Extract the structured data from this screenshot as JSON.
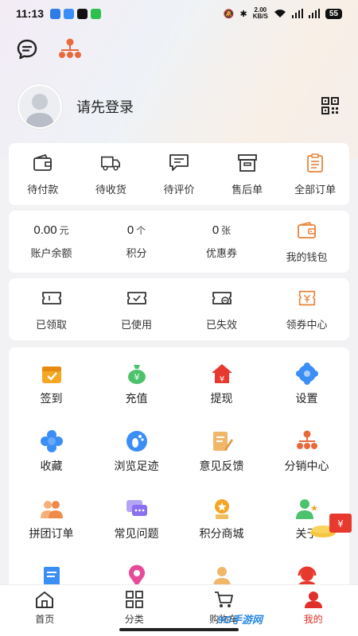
{
  "status_bar": {
    "time": "11:13",
    "net_speed": "2.00",
    "net_unit": "KB/S",
    "battery": "55"
  },
  "profile": {
    "login_prompt": "请先登录"
  },
  "orders": [
    {
      "label": "待付款",
      "icon": "wallet-icon"
    },
    {
      "label": "待收货",
      "icon": "truck-icon"
    },
    {
      "label": "待评价",
      "icon": "comment-icon"
    },
    {
      "label": "售后单",
      "icon": "box-icon"
    },
    {
      "label": "全部订单",
      "icon": "clipboard-icon"
    }
  ],
  "assets": [
    {
      "value": "0.00",
      "unit": "元",
      "label": "账户余额"
    },
    {
      "value": "0",
      "unit": "个",
      "label": "积分"
    },
    {
      "value": "0",
      "unit": "张",
      "label": "优惠券"
    },
    {
      "label": "我的钱包",
      "icon": "wallet-icon"
    }
  ],
  "coupons": [
    {
      "label": "已领取",
      "icon": "ticket-icon"
    },
    {
      "label": "已使用",
      "icon": "ticket-used-icon"
    },
    {
      "label": "已失效",
      "icon": "ticket-expired-icon"
    },
    {
      "label": "领券中心",
      "icon": "coupon-center-icon"
    }
  ],
  "services": [
    {
      "label": "签到",
      "icon": "calendar-check-icon",
      "color": "#f5a623"
    },
    {
      "label": "充值",
      "icon": "money-bag-icon",
      "color": "#4cc36b"
    },
    {
      "label": "提现",
      "icon": "house-money-icon",
      "color": "#e8392f"
    },
    {
      "label": "设置",
      "icon": "gear-icon",
      "color": "#3a8ef6"
    },
    {
      "label": "收藏",
      "icon": "flower-icon",
      "color": "#3a8ef6"
    },
    {
      "label": "浏览足迹",
      "icon": "footprint-icon",
      "color": "#3a8ef6"
    },
    {
      "label": "意见反馈",
      "icon": "edit-doc-icon",
      "color": "#f0b76b"
    },
    {
      "label": "分销中心",
      "icon": "org-chart-icon",
      "color": "#e86a3a"
    },
    {
      "label": "拼团订单",
      "icon": "group-icon",
      "color": "#f08a4b"
    },
    {
      "label": "常见问题",
      "icon": "chat-bubbles-icon",
      "color": "#8a6ff0"
    },
    {
      "label": "积分商城",
      "icon": "medal-icon",
      "color": "#f5a623"
    },
    {
      "label": "关于",
      "icon": "person-star-icon",
      "color": "#4cc36b"
    },
    {
      "label": "",
      "icon": "document-icon",
      "color": "#3a8ef6"
    },
    {
      "label": "",
      "icon": "location-icon",
      "color": "#e84a9a"
    },
    {
      "label": "",
      "icon": "person-icon",
      "color": "#f0b76b"
    },
    {
      "label": "",
      "icon": "headset-icon",
      "color": "#e8392f"
    }
  ],
  "bottom_nav": [
    {
      "label": "首页",
      "icon": "home-icon"
    },
    {
      "label": "分类",
      "icon": "grid-icon"
    },
    {
      "label": "购物车",
      "icon": "cart-icon"
    },
    {
      "label": "我的",
      "icon": "user-icon",
      "active": true
    }
  ],
  "watermark": "9G手游网",
  "colors": {
    "accent": "#e0302a",
    "orange": "#e8843a"
  }
}
